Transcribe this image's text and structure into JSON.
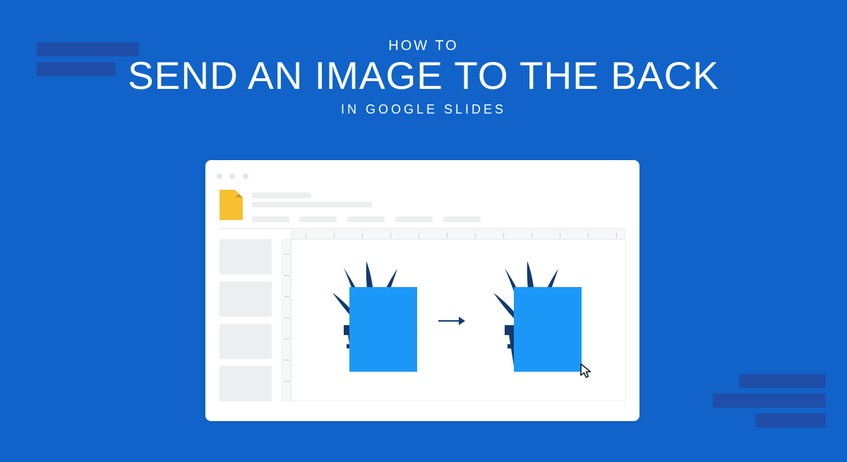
{
  "title": {
    "pre": "HOW TO",
    "main": "SEND AN IMAGE TO THE BACK",
    "sub": "IN GOOGLE SLIDES"
  },
  "illustration": {
    "left_state": "rectangle-in-front-of-plant",
    "right_state": "rectangle-behind-plant",
    "arrow_label": "send-to-back",
    "plant_color": "#133a6d",
    "rect_color": "#1b98f7",
    "pointer": "cursor-arrow"
  },
  "decorations": {
    "top_left_bars": 2,
    "bottom_right_bars": 3
  }
}
